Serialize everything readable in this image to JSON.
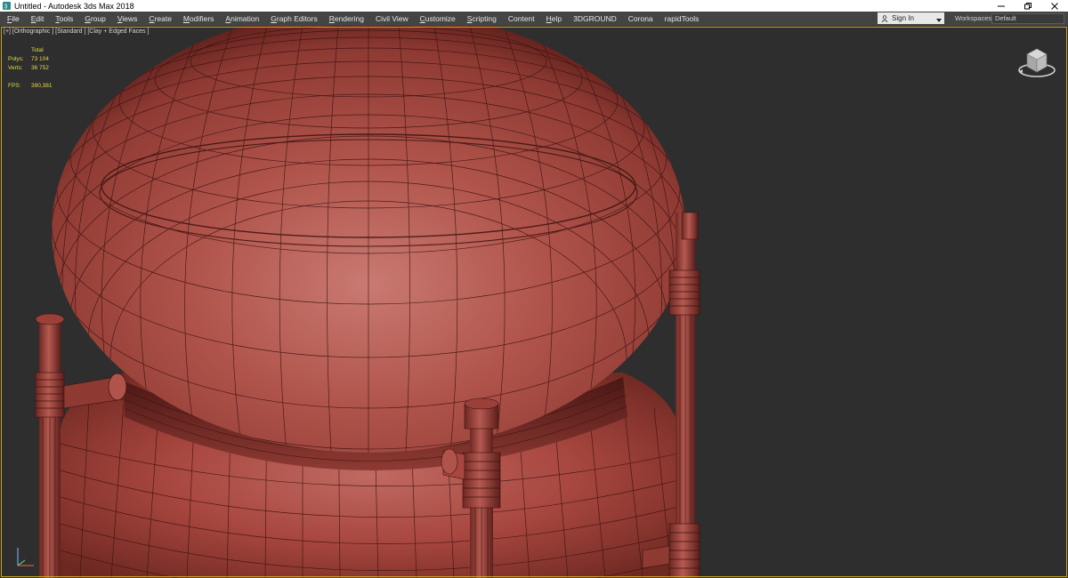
{
  "window": {
    "title": "Untitled - Autodesk 3ds Max 2018",
    "icons": [
      "app-icon-3ds",
      "minimize-icon",
      "restore-icon",
      "close-icon"
    ]
  },
  "menubar": {
    "items": [
      {
        "label": "File",
        "underline": "F",
        "rest": "ile"
      },
      {
        "label": "Edit",
        "underline": "E",
        "rest": "dit"
      },
      {
        "label": "Tools",
        "underline": "T",
        "rest": "ools"
      },
      {
        "label": "Group",
        "underline": "G",
        "rest": "roup"
      },
      {
        "label": "Views",
        "underline": "V",
        "rest": "iews"
      },
      {
        "label": "Create",
        "underline": "C",
        "rest": "reate"
      },
      {
        "label": "Modifiers",
        "underline": "M",
        "rest": "odifiers"
      },
      {
        "label": "Animation",
        "underline": "A",
        "rest": "nimation"
      },
      {
        "label": "Graph Editors",
        "underline": "G",
        "rest": "raph Editors"
      },
      {
        "label": "Rendering",
        "underline": "R",
        "rest": "endering"
      },
      {
        "label": "Civil View",
        "underline": "",
        "rest": "Civil View"
      },
      {
        "label": "Customize",
        "underline": "C",
        "rest": "ustomize"
      },
      {
        "label": "Scripting",
        "underline": "S",
        "rest": "cripting"
      },
      {
        "label": "Content",
        "underline": "",
        "rest": "Content"
      },
      {
        "label": "Help",
        "underline": "H",
        "rest": "elp"
      },
      {
        "label": "3DGROUND",
        "underline": "",
        "rest": "3DGROUND"
      },
      {
        "label": "Corona",
        "underline": "",
        "rest": "Corona"
      },
      {
        "label": "rapidTools",
        "underline": "",
        "rest": "rapidTools"
      }
    ],
    "signin_label": "Sign In",
    "workspaces_label": "Workspaces:",
    "workspaces_value": "Default"
  },
  "viewport": {
    "label": "[+] [Orthographic ] [Standard ] [Clay + Edged Faces ]",
    "stats": {
      "total_label": "Total",
      "polys_label": "Polys:",
      "polys_value": "73 104",
      "verts_label": "Verts:",
      "verts_value": "36 752",
      "fps_label": "FPS:",
      "fps_value": "390,381"
    },
    "colors": {
      "clay": "#a8473f",
      "clay_light": "#c97a72",
      "clay_dark": "#5e1f1b",
      "wire": "#3a1210",
      "selection_border": "#c9a227",
      "stats_text": "#e6d84a"
    },
    "widgets": [
      "viewcube",
      "axis-tripod"
    ]
  }
}
